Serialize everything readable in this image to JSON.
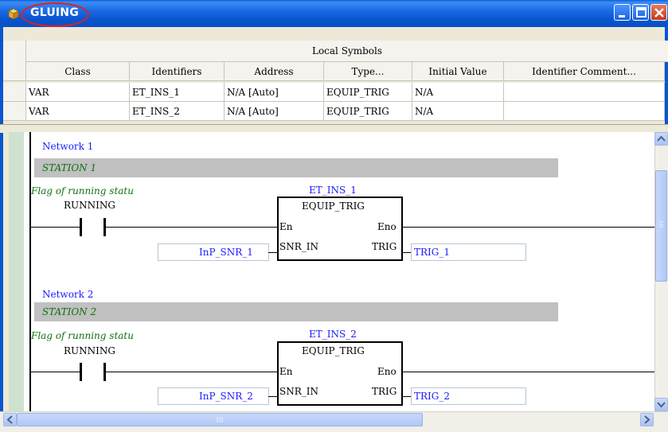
{
  "window": {
    "title": "GLUING"
  },
  "symbols": {
    "section_title": "Local Symbols",
    "columns": [
      "Class",
      "Identifiers",
      "Address",
      "Type...",
      "Initial Value",
      "Identifier Comment..."
    ],
    "rows": [
      [
        "VAR",
        "ET_INS_1",
        "N/A [Auto]",
        "EQUIP_TRIG",
        "N/A",
        ""
      ],
      [
        "VAR",
        "ET_INS_2",
        "N/A [Auto]",
        "EQUIP_TRIG",
        "N/A",
        ""
      ]
    ]
  },
  "networks": [
    {
      "label": "Network 1",
      "title": "STATION 1",
      "contact_comment": "Flag of running statu",
      "contact_name": "RUNNING",
      "instance": "ET_INS_1",
      "fb_type": "EQUIP_TRIG",
      "pin_en": "En",
      "pin_eno": "Eno",
      "pin_in": "SNR_IN",
      "pin_out": "TRIG",
      "input_var": "InP_SNR_1",
      "output_var": "TRIG_1"
    },
    {
      "label": "Network 2",
      "title": "STATION 2",
      "contact_comment": "Flag of running statu",
      "contact_name": "RUNNING",
      "instance": "ET_INS_2",
      "fb_type": "EQUIP_TRIG",
      "pin_en": "En",
      "pin_eno": "Eno",
      "pin_in": "SNR_IN",
      "pin_out": "TRIG",
      "input_var": "InP_SNR_2",
      "output_var": "TRIG_2"
    }
  ],
  "icons": {
    "app": "package-icon",
    "minimize": "minimize-icon",
    "maximize": "maximize-icon",
    "close": "close-icon",
    "collapse": "splitter-grip-icon",
    "scroll_up": "arrow-up-icon",
    "scroll_down": "arrow-down-icon",
    "scroll_left": "arrow-left-icon",
    "scroll_right": "arrow-right-icon"
  },
  "colors": {
    "titlebar": "#0a55d0",
    "highlight_ring": "#e02020",
    "network_label": "#1a1aff",
    "comment_green": "#107010",
    "network_bar": "#c0c0c0"
  }
}
